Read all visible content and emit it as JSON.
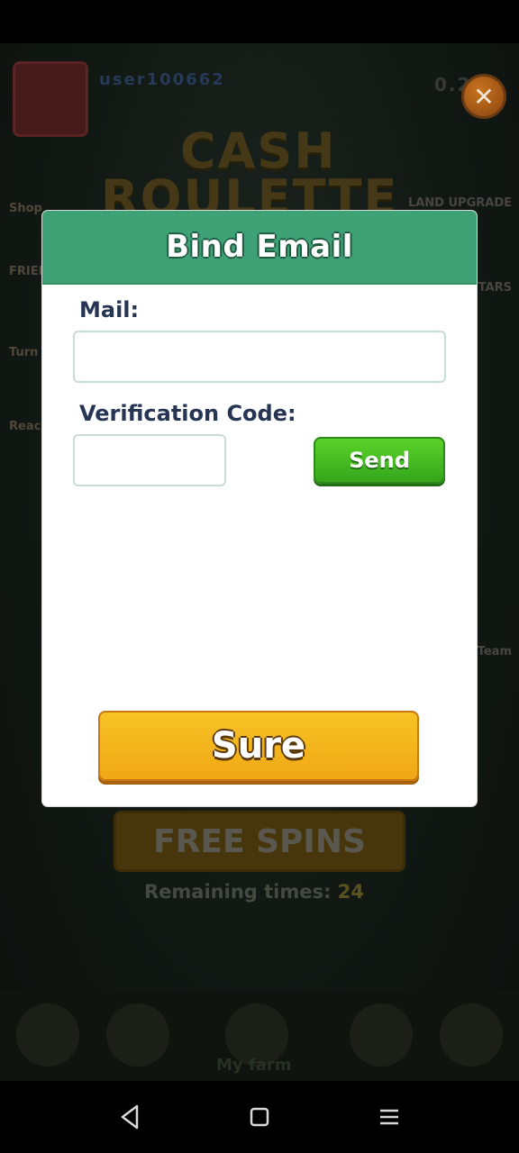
{
  "background": {
    "user_name": "user100662",
    "balance": "0.2",
    "title_line1": "CASH",
    "title_line2": "ROULETTE",
    "left_labels": [
      "Shop",
      "FRIENDS HELP",
      "Turn",
      "Reach card"
    ],
    "right_labels": [
      "LAND UPGRADE",
      "STARS",
      "Team"
    ],
    "free_spins_label": "FREE SPINS",
    "remaining_label": "Remaining times:",
    "remaining_count": "24",
    "bottom_farm_label": "My farm"
  },
  "modal": {
    "title": "Bind Email",
    "mail_label": "Mail:",
    "mail_value": "",
    "code_label": "Verification Code:",
    "code_value": "",
    "send_label": "Send",
    "sure_label": "Sure"
  },
  "close_button": {
    "glyph": "✕",
    "icon": "close-icon"
  },
  "nav": {
    "back_icon": "back-icon",
    "home_icon": "home-icon",
    "menu_icon": "menu-icon"
  },
  "colors": {
    "header_green": "#3fa277",
    "send_green": "#33a61b",
    "sure_orange": "#f0a814",
    "label_navy": "#263553"
  }
}
